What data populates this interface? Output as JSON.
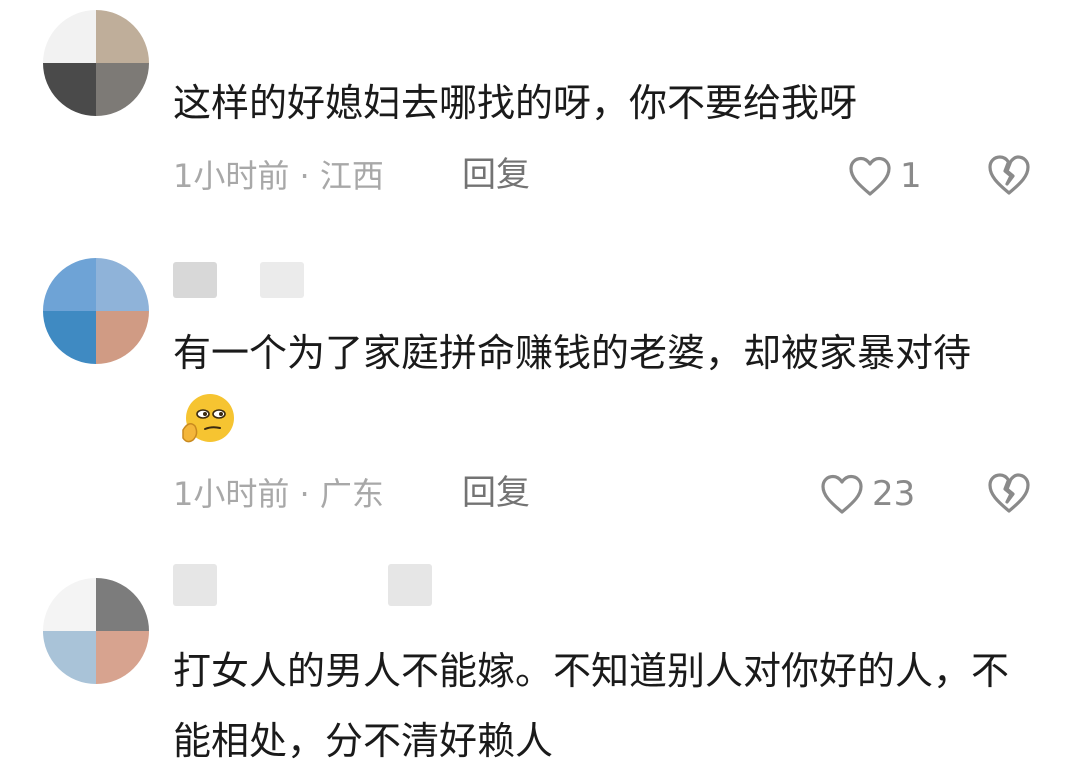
{
  "comments": [
    {
      "text": "这样的好媳妇去哪找的呀，你不要给我呀",
      "time_location": "1小时前 · 江西",
      "reply_label": "回复",
      "like_count": "1"
    },
    {
      "text": "有一个为了家庭拼命赚钱的老婆，却被家暴对待",
      "emoji": "smirk-thinking-emoji",
      "time_location": "1小时前 · 广东",
      "reply_label": "回复",
      "like_count": "23"
    },
    {
      "text": "打女人的男人不能嫁。不知道别人对你好的人，不能相处，分不清好赖人"
    }
  ],
  "icons": {
    "like": "heart-outline-icon",
    "dislike": "broken-heart-icon"
  },
  "colors": {
    "text": "#1a1a1a",
    "meta": "#a8a8a8",
    "reply": "#737373",
    "icon": "#8a8a8a"
  }
}
